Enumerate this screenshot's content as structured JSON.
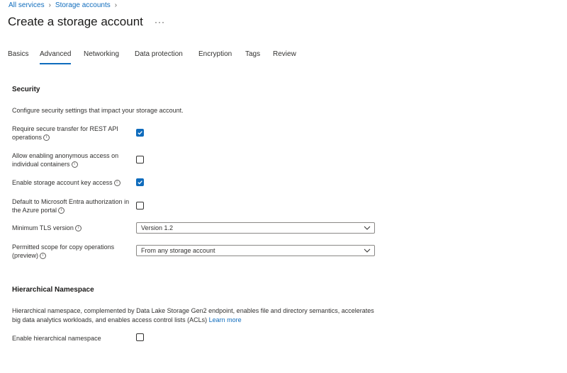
{
  "breadcrumb": {
    "items": [
      "All services",
      "Storage accounts"
    ]
  },
  "header": {
    "title": "Create a storage account",
    "more": "···"
  },
  "tabs": [
    {
      "label": "Basics",
      "active": false
    },
    {
      "label": "Advanced",
      "active": true
    },
    {
      "label": "Networking",
      "active": false
    },
    {
      "label": "Data protection",
      "active": false
    },
    {
      "label": "Encryption",
      "active": false
    },
    {
      "label": "Tags",
      "active": false
    },
    {
      "label": "Review",
      "active": false
    }
  ],
  "security": {
    "heading": "Security",
    "description": "Configure security settings that impact your storage account.",
    "secure_transfer": {
      "label": "Require secure transfer for REST API operations",
      "checked": true
    },
    "anonymous_access": {
      "label": "Allow enabling anonymous access on individual containers",
      "checked": false
    },
    "key_access": {
      "label": "Enable storage account key access",
      "checked": true
    },
    "entra_default": {
      "label": "Default to Microsoft Entra authorization in the Azure portal",
      "checked": false
    },
    "tls": {
      "label": "Minimum TLS version",
      "value": "Version 1.2"
    },
    "copy_scope": {
      "label": "Permitted scope for copy operations (preview)",
      "value": "From any storage account"
    }
  },
  "hns": {
    "heading": "Hierarchical Namespace",
    "description": "Hierarchical namespace, complemented by Data Lake Storage Gen2 endpoint, enables file and directory semantics, accelerates big data analytics workloads, and enables access control lists (ACLs)",
    "learn_more": "Learn more",
    "enable": {
      "label": "Enable hierarchical namespace",
      "checked": false
    }
  },
  "colors": {
    "accent": "#0f6cbd",
    "text": "#323130",
    "border": "#8a8886"
  },
  "icons": {
    "info": "info-icon",
    "chevron": "chevron-down-icon",
    "breadcrumb_sep": "chevron-right-icon"
  }
}
